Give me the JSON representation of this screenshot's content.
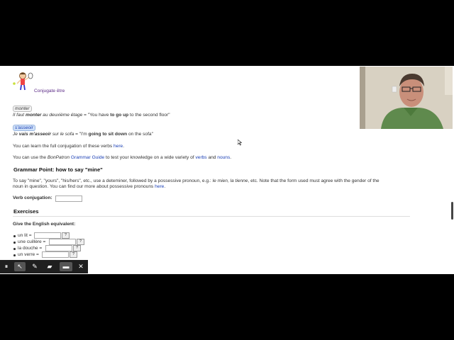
{
  "header": {
    "conjugate_link": "Conjugate être"
  },
  "examples": [
    {
      "verb": "monter",
      "sentence_fr_a": "Il faut ",
      "sentence_fr_b": "monter",
      "sentence_fr_c": " au deuxième étage",
      "eq": " = \"You have ",
      "en_b": "to go up",
      "en_c": " to the second floor\""
    },
    {
      "verb": "s'asseoir",
      "sentence_fr_a": "Je ",
      "sentence_fr_b": "vais m'asseoir",
      "sentence_fr_c": " sur le sofa",
      "eq": " = \"I'm ",
      "en_b": "going to sit down",
      "en_c": " on the sofa\""
    }
  ],
  "learn_line": {
    "text": "You can learn the full conjugation of these verbs ",
    "link": "here",
    "end": "."
  },
  "bonpatron_line": {
    "a": "You can use the ",
    "b": "BonPatron",
    "c": " ",
    "link1": "Grammar Guide",
    "d": " to test your knowledge on a wide variety of ",
    "link2": "verbs",
    "e": " and ",
    "link3": "nouns",
    "f": "."
  },
  "grammar": {
    "heading": "Grammar Point: how to say \"mine\"",
    "p1a": "To say \"mine\", \"yours\", \"his/hers\", etc., use a deteminer, followed by a possessive pronoun, e.g.: ",
    "p1b": "le mien, la tienne",
    "p1c": ", etc. Note that the form used must agree with the gender of the",
    "p2a": "noun in question. You can find our more about possessive pronouns ",
    "p2link": "here",
    "p2end": "."
  },
  "verb_conjugation_label": "Verb conjugation:",
  "exercises": {
    "heading": "Exercises",
    "instruction": "Give the English equivalent:",
    "items": [
      "un lit =",
      "une cuillère =",
      "la douche =",
      "un verre ="
    ],
    "hint_button": "?"
  },
  "toolbar": {
    "buttons": [
      "pause-icon",
      "pointer-icon",
      "pen-icon",
      "eraser-icon",
      "camera-icon",
      "close-icon"
    ],
    "glyphs": [
      "⏸",
      "↖",
      "✎",
      "▰",
      "▬",
      "✕"
    ]
  }
}
